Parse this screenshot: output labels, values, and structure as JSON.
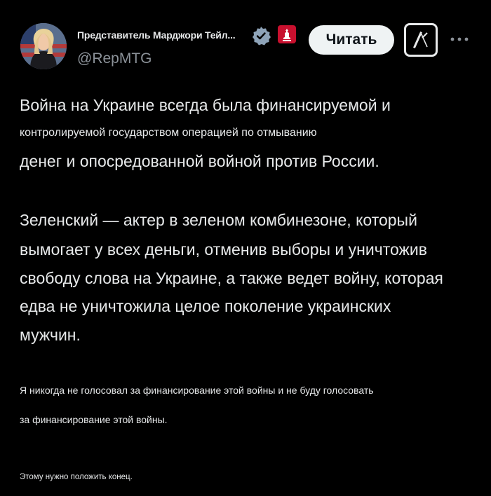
{
  "author": {
    "display_name": "Представитель Марджори Тейл...",
    "handle": "@RepMTG",
    "avatar_icon": "avatar-portrait-icon",
    "verified_icon": "verified-badge-icon",
    "affiliation_icon": "house-of-representatives-seal-icon"
  },
  "actions": {
    "follow_label": "Читать",
    "x_logo_icon": "x-logo-icon",
    "more_icon": "more-dots-icon"
  },
  "post": {
    "lines": [
      "Война на Украине всегда была финансируемой и",
      "контролируемой государством операцией по отмыванию",
      "денег и опосредованной войной против России.",
      "Зеленский — актер в зеленом комбинезоне, который",
      "вымогает у всех деньги, отменив выборы и уничтожив",
      "свободу слова на Украине, а также ведет войну, которая",
      "едва не уничтожила целое поколение украинских",
      "мужчин.",
      "Я никогда не голосовал за финансирование этой войны и не буду голосовать",
      "за финансирование этой войны.",
      "Этому нужно положить конец."
    ]
  },
  "colors": {
    "background": "#000000",
    "text": "#e7e9ea",
    "secondary_text": "#8b9198",
    "verified_badge": "#8ea3b8",
    "affiliation_badge": "#c8102e",
    "follow_button_bg": "#eff3f4"
  }
}
